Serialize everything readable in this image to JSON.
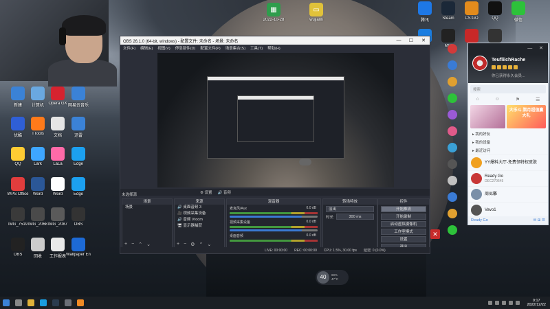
{
  "desktop": {
    "icons_top": [
      {
        "name": "2022-10-28",
        "color": "#2e9d4c"
      },
      {
        "name": "wujianli",
        "color": "#e1c23a"
      }
    ],
    "icons_left": [
      {
        "label": "新建",
        "color": "#3b82d6"
      },
      {
        "label": "计算机",
        "color": "#6aa8e0"
      },
      {
        "label": "Opera GX",
        "color": "#d6232f"
      },
      {
        "label": "网易云音乐",
        "color": "#3b82d6"
      },
      {
        "label": "优酷",
        "color": "#2f5fd6"
      },
      {
        "label": "TTools",
        "color": "#ff7a1a"
      },
      {
        "label": "文档",
        "color": "#e5e5e5"
      },
      {
        "label": "迅雷",
        "color": "#3b82d6"
      },
      {
        "label": "QQ",
        "color": "#ffcc33"
      },
      {
        "label": "Lark",
        "color": "#3ea6ff"
      },
      {
        "label": "LaLa",
        "color": "#ff6aa8"
      },
      {
        "label": "Edge",
        "color": "#1ca0f0"
      },
      {
        "label": "WPS Office",
        "color": "#e13d3d"
      },
      {
        "label": "Word",
        "color": "#2b5797"
      },
      {
        "label": "Word",
        "color": "#ffffff"
      },
      {
        "label": "Edge",
        "color": "#1ca0f0"
      },
      {
        "label": "IMG_7519",
        "color": "#3a3a3a"
      },
      {
        "label": "IMG_2068",
        "color": "#4a4a4a"
      },
      {
        "label": "IMG_2087",
        "color": "#5a5a5a"
      },
      {
        "label": "OBS",
        "color": "#333333"
      },
      {
        "label": "OBS",
        "color": "#222222"
      },
      {
        "label": "回收",
        "color": "#cccccc"
      },
      {
        "label": "工作报表",
        "color": "#e9e9e9"
      },
      {
        "label": "Wallpaper Engine",
        "color": "#1d6ad6"
      }
    ],
    "icons_right": [
      {
        "label": "腾讯",
        "color": "#1e78e6"
      },
      {
        "label": "Steam",
        "color": "#1b2838"
      },
      {
        "label": "CS:GO",
        "color": "#e38b1c"
      },
      {
        "label": "QQ",
        "color": "#111111"
      },
      {
        "label": "微信",
        "color": "#2dc23a"
      },
      {
        "label": "Uplay",
        "color": "#1a7de0"
      },
      {
        "label": "MW",
        "color": "#222222"
      },
      {
        "label": "NE",
        "color": "#c82828"
      },
      {
        "label": "MW WZ",
        "color": "#333333"
      }
    ]
  },
  "obs": {
    "title": "OBS 26.1.0 (64-bit, windows) - 配置文件: 未命名 - 场景: 未命名",
    "window_controls": [
      "—",
      "☐",
      "✕"
    ],
    "menu": [
      "文件(F)",
      "编辑(E)",
      "视图(V)",
      "停靠部件(D)",
      "配置文件(P)",
      "场景集合(S)",
      "工具(T)",
      "帮助(H)"
    ],
    "audio_bar": [
      "⚙ 设置",
      "🔊 音频"
    ],
    "no_source_label": "未选择源",
    "panes": {
      "scenes": {
        "title": "场景",
        "items": [
          "场景"
        ]
      },
      "sources": {
        "title": "来源",
        "items": [
          "🔊 桌面音频 3",
          "🎥 视频采集设备",
          "🔊 音频 Vroom",
          "🖥 显示器捕获"
        ]
      },
      "mixer": {
        "title": "混音器",
        "channels": [
          {
            "name": "麦克风/Aux",
            "db": "0.0 dB",
            "level": 0.82
          },
          {
            "name": "视频采集设备",
            "db": "0.0 dB",
            "level": 0.82
          },
          {
            "name": "桌面音频",
            "db": "0.0 dB",
            "level": 0.82
          }
        ]
      },
      "transitions": {
        "title": "转场特效",
        "type": "淡出",
        "duration_label": "时长",
        "duration": "300 ms"
      },
      "controls": {
        "title": "控件",
        "buttons": [
          "开始推流",
          "开始录制",
          "启动虚拟摄像机",
          "工作室模式",
          "设置",
          "退出"
        ]
      }
    },
    "status": [
      "LIVE: 00:00:00",
      "REC: 00:00:00",
      "CPU: 1.5%, 30.00 fps",
      "延迟: 0 (0.0%)"
    ]
  },
  "qq": {
    "name": "TeufliichRache",
    "signature": "你已获得永久会员...",
    "search_placeholder": "搜索",
    "tabs": [
      "⌂",
      "☺",
      "⚑",
      "☰"
    ],
    "banner_text": "大乐斗 腊月超值赢大礼",
    "groups": [
      {
        "label": "▸ 我的好友"
      },
      {
        "label": "▸ 我的设备"
      },
      {
        "label": "▸ 最近访问"
      }
    ],
    "items": [
      {
        "title": "YY爆料大厅-免费领特权皮肤",
        "sub": "",
        "color": "#f0a020"
      },
      {
        "title": "Ready Go",
        "sub": "DEC270645",
        "color": "#c83737"
      },
      {
        "title": "周似雕",
        "sub": "",
        "color": "#7a8fa8"
      },
      {
        "title": "Vavo1",
        "sub": "",
        "color": "#555555"
      }
    ],
    "footer_left": "Ready Go",
    "footer_icons": "✉ ⊞ ☰"
  },
  "perf": {
    "fps": "40",
    "top": "69%",
    "bottom": "47°C"
  },
  "taskbar": {
    "apps": [
      {
        "name": "start",
        "color": "#3b82d6"
      },
      {
        "name": "search",
        "color": "#888888"
      },
      {
        "name": "explorer",
        "color": "#e1b23a"
      },
      {
        "name": "qq",
        "color": "#1a9de0"
      },
      {
        "name": "steam",
        "color": "#2b3b4e"
      },
      {
        "name": "obs",
        "color": "#6c6f77"
      },
      {
        "name": "app",
        "color": "#f08a24"
      }
    ],
    "time": "0:17",
    "date": "2022/12/22"
  }
}
